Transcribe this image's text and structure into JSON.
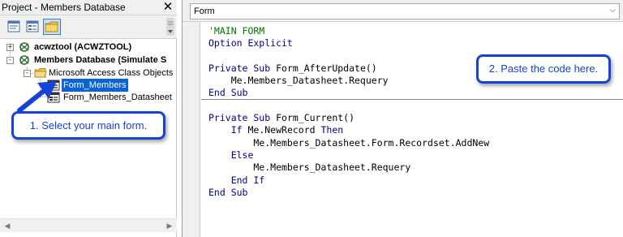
{
  "project": {
    "title": "Project - Members Database",
    "close_glyph": "✕",
    "toolbar": {
      "view_code_icon": "view-code-icon",
      "view_object_icon": "view-object-icon",
      "toggle_folders_icon": "folder-icon"
    },
    "tree": {
      "items": [
        {
          "label": "acwztool (ACWZTOOL)",
          "expander": "+",
          "icon": "vba-project-icon"
        },
        {
          "label": "Members Database (Simulate S",
          "expander": "-",
          "icon": "vba-project-icon"
        },
        {
          "label": "Microsoft Access Class Objects",
          "expander": "-",
          "icon": "folder-icon"
        },
        {
          "label": "Form_Members",
          "icon": "form-module-icon",
          "selected": true
        },
        {
          "label": "Form_Members_Datasheet",
          "icon": "form-module-icon"
        }
      ]
    }
  },
  "code_window": {
    "object_combo": "Form",
    "lines": [
      [
        {
          "t": "'MAIN FORM",
          "c": "cm"
        }
      ],
      [
        {
          "t": "Option Explicit",
          "c": "kw"
        }
      ],
      [],
      [
        {
          "t": "Private Sub ",
          "c": "kw"
        },
        {
          "t": "Form_AfterUpdate()",
          "c": ""
        }
      ],
      [
        {
          "t": "    Me.Members_Datasheet.Requery",
          "c": ""
        }
      ],
      [
        {
          "t": "End Sub",
          "c": "kw"
        }
      ],
      [],
      [
        {
          "t": "Private Sub ",
          "c": "kw"
        },
        {
          "t": "Form_Current()",
          "c": ""
        }
      ],
      [
        {
          "t": "    ",
          "c": ""
        },
        {
          "t": "If ",
          "c": "kw"
        },
        {
          "t": "Me.NewRecord ",
          "c": ""
        },
        {
          "t": "Then",
          "c": "kw"
        }
      ],
      [
        {
          "t": "        Me.Members_Datasheet.Form.Recordset.AddNew",
          "c": ""
        }
      ],
      [
        {
          "t": "    ",
          "c": ""
        },
        {
          "t": "Else",
          "c": "kw"
        }
      ],
      [
        {
          "t": "        Me.Members_Datasheet.Requery",
          "c": ""
        }
      ],
      [
        {
          "t": "    ",
          "c": ""
        },
        {
          "t": "End If",
          "c": "kw"
        }
      ],
      [
        {
          "t": "End Sub",
          "c": "kw"
        }
      ]
    ]
  },
  "callouts": {
    "select_form": "1. Select your main form.",
    "paste_code": "2. Paste the code here."
  },
  "colors": {
    "callout_blue": "#1742d7",
    "keyword_blue": "#00008b",
    "comment_green": "#007400",
    "selection_blue": "#0a64d8"
  }
}
